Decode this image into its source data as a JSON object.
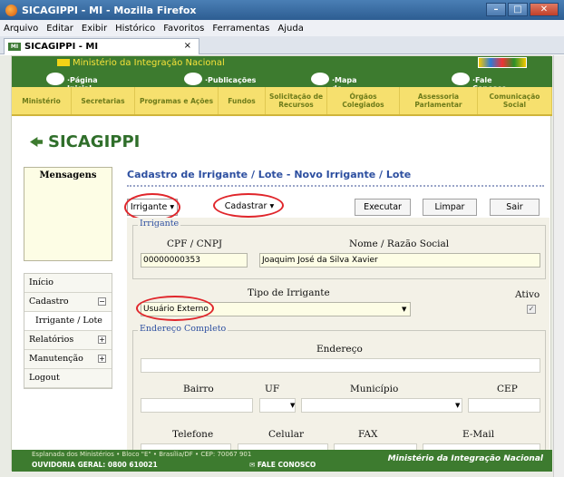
{
  "window": {
    "title": "SICAGIPPI - MI - Mozilla Firefox"
  },
  "menubar": [
    "Arquivo",
    "Editar",
    "Exibir",
    "Histórico",
    "Favoritos",
    "Ferramentas",
    "Ajuda"
  ],
  "tab": {
    "title": "SICAGIPPI - MI",
    "favicon": "mi-favicon",
    "close": "×"
  },
  "gov": {
    "ministry": "Ministério da Integração Nacional",
    "nav": [
      "·Página Inicial",
      "·Publicações",
      "·Mapa do Site",
      "·Fale Conosco"
    ],
    "brasil": "BRASIL"
  },
  "menu": [
    "Ministério",
    "Secretarias",
    "Programas e Ações",
    "Fundos",
    "Solicitação de Recursos",
    "Órgãos Colegiados",
    "Assessoria Parlamentar",
    "Comunicação Social"
  ],
  "brand": "SICAGIPPI",
  "messages": {
    "heading": "Mensagens"
  },
  "sidebar": {
    "inicio": "Início",
    "cadastro": "Cadastro",
    "irrigante_lote": "Irrigante / Lote",
    "relatorios": "Relatórios",
    "manutencao": "Manutenção",
    "logout": "Logout",
    "minus": "−",
    "plus": "+"
  },
  "page": {
    "title": "Cadastro de Irrigante / Lote - Novo Irrigante / Lote"
  },
  "toolbar": {
    "irrigante": "Irrigante",
    "cadastrar": "Cadastrar",
    "executar": "Executar",
    "limpar": "Limpar",
    "sair": "Sair"
  },
  "form": {
    "irrigante_legend": "Irrigante",
    "cpf_label": "CPF / CNPJ",
    "cpf_value": "00000000353",
    "nome_label": "Nome / Razão Social",
    "nome_value": "Joaquim José da Silva Xavier",
    "tipo_label": "Tipo de Irrigante",
    "tipo_value": "Usuário Externo",
    "ativo_label": "Ativo",
    "ativo_check": "✓",
    "endereco_legend": "Endereço Completo",
    "endereco_label": "Endereço",
    "bairro_label": "Bairro",
    "uf_label": "UF",
    "municipio_label": "Município",
    "cep_label": "CEP",
    "telefone_label": "Telefone",
    "celular_label": "Celular",
    "fax_label": "FAX",
    "email_label": "E-Mail"
  },
  "footer": {
    "address": "Esplanada dos Ministérios • Bloco \"E\" • Brasília/DF • CEP: 70067 901",
    "ouvidoria": "OUVIDORIA GERAL: 0800 610021",
    "fale": "FALE CONOSCO",
    "ministry": "Ministério da Integração Nacional"
  },
  "colors": {
    "green": "#3d7b2f",
    "yellow": "#f6e06e",
    "annotation": "#e0262b"
  }
}
